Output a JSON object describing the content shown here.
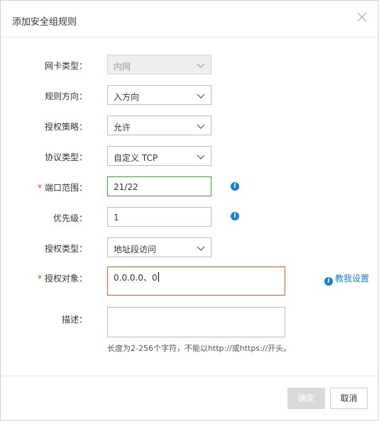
{
  "dialog": {
    "title": "添加安全组规则",
    "close_icon": "close-icon"
  },
  "form": {
    "nic_type": {
      "label": "网卡类型：",
      "value": "内网",
      "disabled": true
    },
    "direction": {
      "label": "规则方向：",
      "value": "入方向"
    },
    "policy": {
      "label": "授权策略：",
      "value": "允许"
    },
    "protocol": {
      "label": "协议类型：",
      "value": "自定义 TCP"
    },
    "port_range": {
      "label": "端口范围：",
      "value": "21/22",
      "required": true,
      "info_icon": "info-icon"
    },
    "priority": {
      "label": "优先级：",
      "value": "1",
      "info_icon": "info-icon"
    },
    "auth_type": {
      "label": "授权类型：",
      "value": "地址段访问"
    },
    "auth_object": {
      "label": "授权对象：",
      "value": "0.0.0.0、0",
      "required": true,
      "help_link": "教我设置"
    },
    "description": {
      "label": "描述：",
      "value": "",
      "hint": "长度为2-256个字符，不能以http://或https://开头。"
    },
    "required_mark": "*"
  },
  "footer": {
    "ok_label": "确定",
    "cancel_label": "取消"
  },
  "colors": {
    "accent": "#1a7dd1",
    "error_border": "#e6592a",
    "focus_border": "#2eab3a",
    "required": "#e0281e"
  }
}
